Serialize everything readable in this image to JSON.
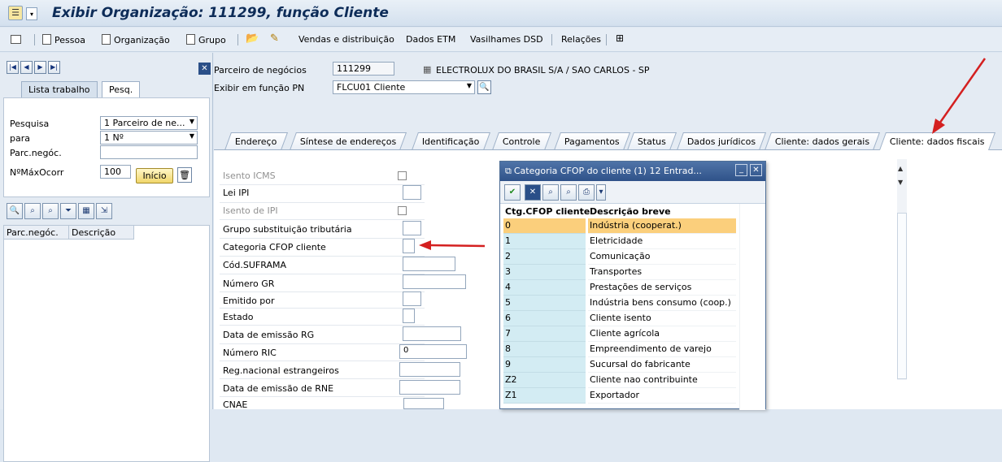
{
  "title": "Exibir Organização: 111299, função Cliente",
  "toolbar": {
    "items": [
      "Pessoa",
      "Organização",
      "Grupo",
      "Vendas e distribuição",
      "Dados ETM",
      "Vasilhames DSD",
      "Relações"
    ]
  },
  "left": {
    "tabs": [
      "Lista trabalho",
      "Pesq."
    ],
    "fields": {
      "pesquisa_label": "Pesquisa",
      "pesquisa_value": "1 Parceiro de ne...",
      "para_label": "para",
      "para_value": "1 Nº",
      "parc_label": "Parc.negóc.",
      "parc_value": "",
      "nmax_label": "NºMáxOcorr",
      "nmax_value": "100",
      "inicio_label": "Início"
    },
    "grid_headers": [
      "Parc.negóc.",
      "Descrição"
    ]
  },
  "header": {
    "parceiro_label": "Parceiro de negócios",
    "parceiro_value": "111299",
    "parceiro_name": "ELECTROLUX DO BRASIL S/A / SAO CARLOS - SP",
    "funcao_label": "Exibir em função PN",
    "funcao_value": "FLCU01 Cliente"
  },
  "tabs": [
    "Endereço",
    "Síntese de endereços",
    "Identificação",
    "Controle",
    "Pagamentos",
    "Status",
    "Dados jurídicos",
    "Cliente: dados gerais",
    "Cliente: dados fiscais"
  ],
  "active_tab": "Cliente: dados fiscais",
  "form": {
    "isento_icms": "Isento ICMS",
    "lei_ipi": "Lei IPI",
    "isento_ipi": "Isento de IPI",
    "grupo_subst": "Grupo substituição tributária",
    "categoria_cfop": "Categoria CFOP cliente",
    "suframa": "Cód.SUFRAMA",
    "numero_gr": "Número GR",
    "emitido_por": "Emitido por",
    "estado": "Estado",
    "data_rg": "Data de emissão RG",
    "numero_ric": "Número RIC",
    "numero_ric_value": "0",
    "reg_estrangeiros": "Reg.nacional estrangeiros",
    "data_rne": "Data de emissão de RNE",
    "cnae": "CNAE"
  },
  "popup": {
    "title": "Categoria CFOP do cliente (1)   12 Entrad...",
    "col_headers": [
      "Ctg.CFOP cliente",
      "Descrição breve"
    ],
    "rows": [
      {
        "code": "0",
        "desc": "Indústria (cooperat.)",
        "selected": true
      },
      {
        "code": "1",
        "desc": "Eletricidade"
      },
      {
        "code": "2",
        "desc": "Comunicação"
      },
      {
        "code": "3",
        "desc": "Transportes"
      },
      {
        "code": "4",
        "desc": "Prestações de serviços"
      },
      {
        "code": "5",
        "desc": "Indústria bens consumo (coop.)"
      },
      {
        "code": "6",
        "desc": "Cliente isento"
      },
      {
        "code": "7",
        "desc": "Cliente agrícola"
      },
      {
        "code": "8",
        "desc": "Empreendimento de varejo"
      },
      {
        "code": "9",
        "desc": "Sucursal do fabricante"
      },
      {
        "code": "Z2",
        "desc": "Cliente nao contribuinte"
      },
      {
        "code": "Z1",
        "desc": "Exportador"
      }
    ]
  },
  "colors": {
    "accent_arrow": "#d42020",
    "selected_row": "#fbcf7c",
    "code_col": "#d3ecf3",
    "title_blue": "#0d2c58"
  }
}
